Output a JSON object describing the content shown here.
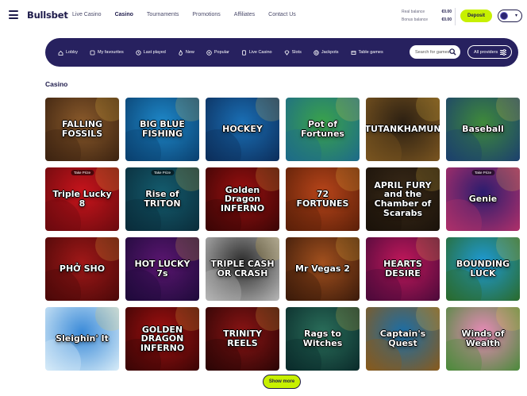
{
  "header": {
    "logo": "Bullsbet",
    "nav": [
      "Live Casino",
      "Casino",
      "Tournaments",
      "Promotions",
      "Affiliates",
      "Contact Us"
    ],
    "active_nav": "Casino",
    "balance": {
      "real_label": "Real balance",
      "real_value": "€0.00",
      "bonus_label": "Bonus balance",
      "bonus_value": "€0.00"
    },
    "deposit_label": "Deposit",
    "profile_icon": "avatar-icon"
  },
  "categories": {
    "items": [
      {
        "label": "Lobby",
        "icon": "home-icon"
      },
      {
        "label": "My favourites",
        "icon": "heart-icon"
      },
      {
        "label": "Last played",
        "icon": "clock-icon"
      },
      {
        "label": "New",
        "icon": "flame-icon"
      },
      {
        "label": "Popular",
        "icon": "star-icon"
      },
      {
        "label": "Live Casino",
        "icon": "card-icon"
      },
      {
        "label": "Slots",
        "icon": "diamond-icon"
      },
      {
        "label": "Jackpots",
        "icon": "coin-icon"
      },
      {
        "label": "Table games",
        "icon": "table-icon"
      }
    ],
    "search_placeholder": "Search for games",
    "providers_label": "All providers"
  },
  "section_title": "Casino",
  "games": [
    {
      "name": "FALLING FOSSILS",
      "bg": "#8a5a2b",
      "bg2": "#3b2210"
    },
    {
      "name": "BIG BLUE FISHING",
      "bg": "#1e88c9",
      "bg2": "#0a3f6e"
    },
    {
      "name": "HOCKEY",
      "bg": "#1a6fb5",
      "bg2": "#0c2d5a"
    },
    {
      "name": "Pot of Fortunes",
      "bg": "#3aa34a",
      "bg2": "#1d6a8a"
    },
    {
      "name": "TUTANKHAMUN",
      "bg": "#2b1f12",
      "bg2": "#7a5520"
    },
    {
      "name": "Baseball",
      "bg": "#3f8a3a",
      "bg2": "#1b3f6e"
    },
    {
      "name": "Triple Lucky 8",
      "bg": "#c8141c",
      "bg2": "#6a0a0e",
      "badge": "Take Prize"
    },
    {
      "name": "Rise of TRITON",
      "bg": "#145c6e",
      "bg2": "#0a2c3a",
      "badge": "Take Prize"
    },
    {
      "name": "Golden Dragon INFERNO",
      "bg": "#9a1010",
      "bg2": "#3a0505"
    },
    {
      "name": "72 FORTUNES",
      "bg": "#b8451a",
      "bg2": "#5a1f08"
    },
    {
      "name": "APRIL FURY and the Chamber of Scarabs",
      "bg": "#3a2a18",
      "bg2": "#1a120a"
    },
    {
      "name": "Genie",
      "bg": "#2a1c6e",
      "bg2": "#b0306a",
      "badge": "Take Prize"
    },
    {
      "name": "PHỞ SHO",
      "bg": "#a01818",
      "bg2": "#4a0808"
    },
    {
      "name": "HOT LUCKY 7s",
      "bg": "#5a1670",
      "bg2": "#1e0a3a"
    },
    {
      "name": "TRIPLE CASH OR CRASH",
      "bg": "#2a2a2a",
      "bg2": "#b8b8b8"
    },
    {
      "name": "Mr Vegas 2",
      "bg": "#a2501e",
      "bg2": "#3a1a0a"
    },
    {
      "name": "HEARTS DESIRE",
      "bg": "#c2185b",
      "bg2": "#4a0a3a"
    },
    {
      "name": "BOUNDING LUCK",
      "bg": "#1e9ad6",
      "bg2": "#2a6a2a"
    },
    {
      "name": "Sleighin' It",
      "bg": "#3a8ad8",
      "bg2": "#d8ecf8"
    },
    {
      "name": "GOLDEN DRAGON INFERNO",
      "bg": "#a01010",
      "bg2": "#3a0505"
    },
    {
      "name": "TRINITY REELS",
      "bg": "#8a1414",
      "bg2": "#2a0505"
    },
    {
      "name": "Rags to Witches",
      "bg": "#2a6e5a",
      "bg2": "#0a2a2a"
    },
    {
      "name": "Captain's Quest",
      "bg": "#1a6ea8",
      "bg2": "#8a5a1a"
    },
    {
      "name": "Winds of Wealth",
      "bg": "#e88ab8",
      "bg2": "#4a8a3a"
    }
  ],
  "show_more_label": "Show more",
  "colors": {
    "primary": "#27215f",
    "accent": "#c7f000",
    "text": "#1e1b4b"
  }
}
